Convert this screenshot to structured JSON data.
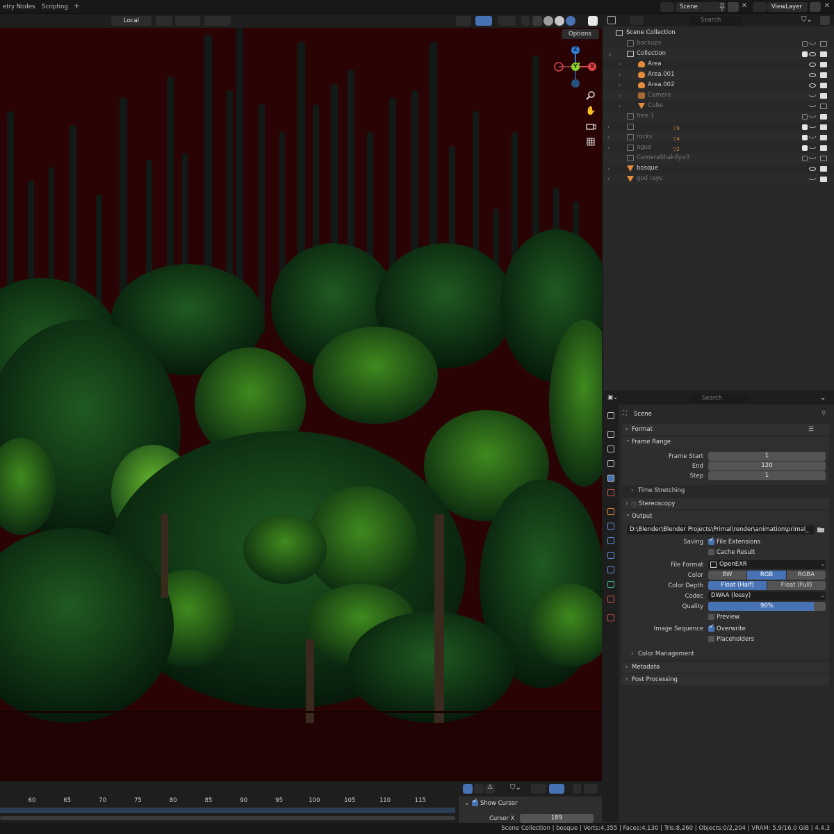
{
  "topbar": {
    "workspace_tabs": [
      "etry Nodes",
      "Scripting"
    ],
    "add_tab": "+",
    "scene_name": "Scene",
    "view_layer": "ViewLayer"
  },
  "viewport_header": {
    "transform_orientation": "Local",
    "options_label": "Options"
  },
  "gizmo": {
    "z": "Z",
    "y": "Y",
    "x": "X"
  },
  "outliner": {
    "search_placeholder": "Search",
    "root": "Scene Collection",
    "items": [
      {
        "label": "backups",
        "dim": true
      },
      {
        "label": "Collection",
        "dim": false
      },
      {
        "label": "Area",
        "dim": false
      },
      {
        "label": "Area.001",
        "dim": false
      },
      {
        "label": "Area.002",
        "dim": false
      },
      {
        "label": "Camera",
        "dim": true
      },
      {
        "label": "Cube",
        "dim": true
      },
      {
        "label": "tree 1",
        "dim": true
      },
      {
        "label": "",
        "dim": true
      },
      {
        "label": "rocks",
        "dim": true
      },
      {
        "label": "agua",
        "dim": true
      },
      {
        "label": "CameraShakify.v3",
        "dim": true
      },
      {
        "label": "bosque",
        "dim": false
      },
      {
        "label": "god rays",
        "dim": true
      }
    ],
    "badges": {
      "rocks_count": "4",
      "agua_count": "2",
      "hidden_count": "9"
    }
  },
  "properties": {
    "search_placeholder": "Search",
    "context": "Scene",
    "panels": {
      "format": "Format",
      "frame_range": "Frame Range",
      "time_stretching": "Time Stretching",
      "stereoscopy": "Stereoscopy",
      "output": "Output",
      "color_management": "Color Management",
      "metadata": "Metadata",
      "post_processing": "Post Processing"
    },
    "frame_range": {
      "start_label": "Frame Start",
      "start": "1",
      "end_label": "End",
      "end": "120",
      "step_label": "Step",
      "step": "1"
    },
    "output": {
      "path": "D:\\Blender\\Blender Projects\\Primal\\render\\animation\\primal_",
      "saving_label": "Saving",
      "file_extensions": "File Extensions",
      "cache_result": "Cache Result",
      "file_format_label": "File Format",
      "file_format": "OpenEXR",
      "color_label": "Color",
      "color_options": [
        "BW",
        "RGB",
        "RGBA"
      ],
      "color_depth_label": "Color Depth",
      "depth_options": [
        "Float (Half)",
        "Float (Full)"
      ],
      "codec_label": "Codec",
      "codec": "DWAA (lossy)",
      "quality_label": "Quality",
      "quality": "90%",
      "quality_value": 0.9,
      "preview": "Preview",
      "image_sequence_label": "Image Sequence",
      "overwrite": "Overwrite",
      "placeholders": "Placeholders"
    }
  },
  "timeline": {
    "ticks": [
      "60",
      "65",
      "70",
      "75",
      "80",
      "85",
      "90",
      "95",
      "100",
      "105",
      "110",
      "115"
    ],
    "show_cursor": "Show Cursor",
    "cursor_x_label": "Cursor X",
    "cursor_x": "189"
  },
  "statusbar": "Scene Collection | bosque | Verts:4,355 | Faces:4,130 | Tris:8,260 | Objects:0/2,204 | VRAM: 5.9/16.0 GiB | 4.4.3",
  "colors": {
    "accent": "#4772b3",
    "viewport_bg": "#2a0404",
    "axis_x": "#e0444b",
    "axis_y": "#8bd02c",
    "axis_z": "#2f7fd6"
  }
}
